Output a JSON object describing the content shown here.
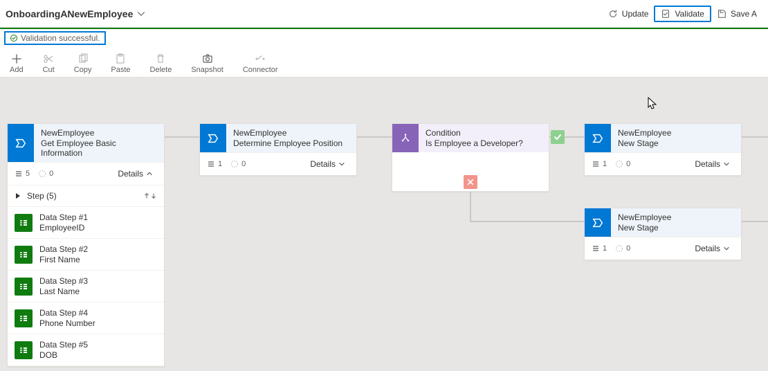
{
  "header": {
    "title": "OnboardingANewEmployee",
    "update": "Update",
    "validate": "Validate",
    "save": "Save A"
  },
  "validation": {
    "message": "Validation successful."
  },
  "toolbar": {
    "add": "Add",
    "cut": "Cut",
    "copy": "Copy",
    "paste": "Paste",
    "delete": "Delete",
    "snapshot": "Snapshot",
    "connector": "Connector"
  },
  "stages": {
    "s1": {
      "t1": "NewEmployee",
      "t2": "Get Employee Basic Information",
      "count1": "5",
      "count2": "0",
      "details": "Details"
    },
    "s2": {
      "t1": "NewEmployee",
      "t2": "Determine Employee Position",
      "count1": "1",
      "count2": "0",
      "details": "Details"
    },
    "cond": {
      "t1": "Condition",
      "t2": "Is Employee a Developer?"
    },
    "s3": {
      "t1": "NewEmployee",
      "t2": "New Stage",
      "count1": "1",
      "count2": "0",
      "details": "Details"
    },
    "s4": {
      "t1": "NewEmployee",
      "t2": "New Stage",
      "count1": "1",
      "count2": "0",
      "details": "Details"
    }
  },
  "stepsHeader": "Step (5)",
  "steps": [
    {
      "title": "Data Step #1",
      "field": "EmployeeID"
    },
    {
      "title": "Data Step #2",
      "field": "First Name"
    },
    {
      "title": "Data Step #3",
      "field": "Last Name"
    },
    {
      "title": "Data Step #4",
      "field": "Phone Number"
    },
    {
      "title": "Data Step #5",
      "field": "DOB"
    }
  ]
}
